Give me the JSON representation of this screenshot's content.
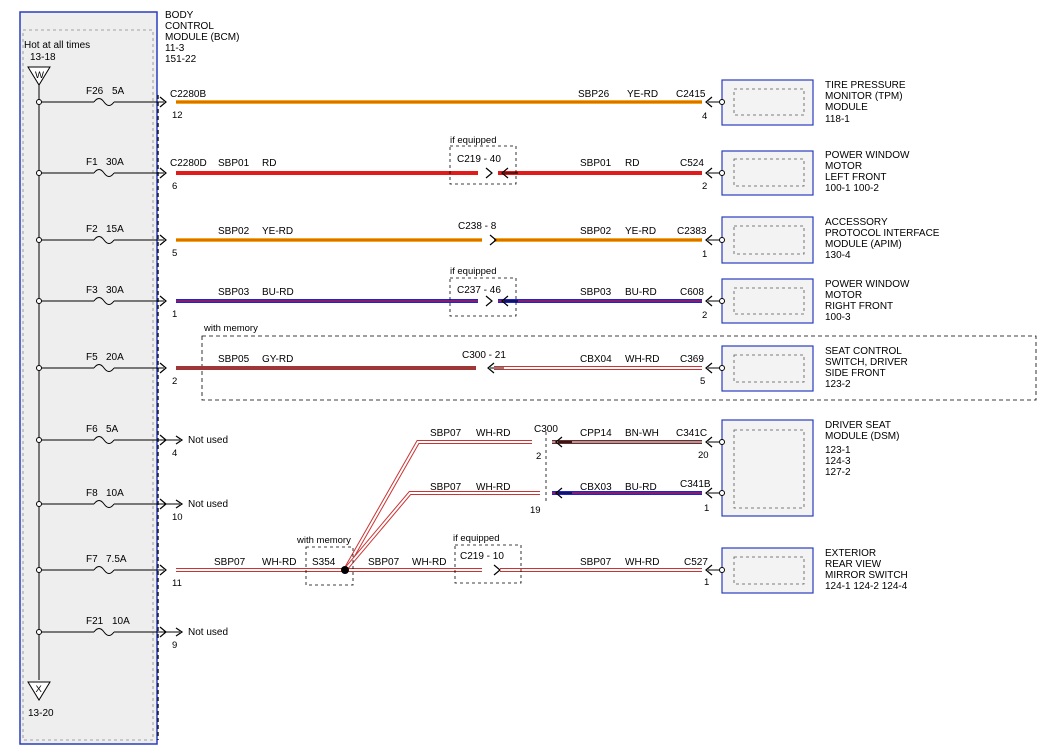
{
  "bcm": {
    "lines": [
      "BODY",
      "CONTROL",
      "MODULE (BCM)",
      "11-3",
      "151-22"
    ],
    "hot_label": "Hot at all times",
    "top_ref": "13-18",
    "top_terminal": "W",
    "bottom_terminal": "X",
    "bottom_ref": "13-20"
  },
  "colors": {
    "ye_rd": "#e8b400",
    "rd": "#e11a1a",
    "bu_rd": "#2323cc",
    "gy_rd": "#8a4040",
    "wh_rd": "#ffffff",
    "bn_wh": "#6b2d2d",
    "bu": "#2323cc",
    "stripe_rd": "#e11a1a",
    "stripe_dark": "#5a1a1a",
    "module_border": "#2a3cc0",
    "bcm_border": "#2a3cc0",
    "bcm_fill": "#eeeeee"
  },
  "fuses": [
    {
      "name": "F26",
      "rating": "5A"
    },
    {
      "name": "F1",
      "rating": "30A"
    },
    {
      "name": "F2",
      "rating": "15A"
    },
    {
      "name": "F3",
      "rating": "30A"
    },
    {
      "name": "F5",
      "rating": "20A"
    },
    {
      "name": "F6",
      "rating": "5A"
    },
    {
      "name": "F8",
      "rating": "10A"
    },
    {
      "name": "F7",
      "rating": "7.5A"
    },
    {
      "name": "F21",
      "rating": "10A"
    }
  ],
  "pins": [
    "12",
    "6",
    "5",
    "1",
    "2",
    "4",
    "10",
    "11",
    "9"
  ],
  "not_used": "Not used",
  "circuits": [
    {
      "left_conn": "C2280B",
      "right_circuit": "SBP26",
      "right_color": "YE-RD",
      "right_conn": "C2415",
      "right_pin": "4"
    },
    {
      "left_conn": "C2280D",
      "left_circuit": "SBP01",
      "left_color": "RD",
      "mid_conn": "C219 - 40",
      "mid_label": "if equipped",
      "right_circuit": "SBP01",
      "right_color": "RD",
      "right_conn": "C524",
      "right_pin": "2"
    },
    {
      "left_circuit": "SBP02",
      "left_color": "YE-RD",
      "mid_conn": "C238 - 8",
      "right_circuit": "SBP02",
      "right_color": "YE-RD",
      "right_conn": "C2383",
      "right_pin": "1"
    },
    {
      "left_circuit": "SBP03",
      "left_color": "BU-RD",
      "mid_conn": "C237 - 46",
      "mid_label": "if equipped",
      "right_circuit": "SBP03",
      "right_color": "BU-RD",
      "right_conn": "C608",
      "right_pin": "2"
    },
    {
      "group_label": "with memory",
      "left_circuit": "SBP05",
      "left_color": "GY-RD",
      "mid_conn": "C300 - 21",
      "right_circuit": "CBX04",
      "right_color": "WH-RD",
      "right_conn": "C369",
      "right_pin": "5"
    },
    {
      "upper_circuit": "SBP07",
      "upper_color": "WH-RD",
      "upper_conn": "C300",
      "upper_conn_pin": "2",
      "upper_right_circuit": "CPP14",
      "upper_right_color": "BN-WH",
      "upper_right_conn": "C341C",
      "upper_right_pin": "20",
      "lower_circuit": "SBP07",
      "lower_color": "WH-RD",
      "lower_conn_pin": "19",
      "lower_right_circuit": "CBX03",
      "lower_right_color": "BU-RD",
      "lower_right_conn": "C341B",
      "lower_right_pin": "1"
    },
    {
      "left_circuit": "SBP07",
      "left_color": "WH-RD",
      "splice_label": "with memory",
      "splice": "S354",
      "mid_circuit": "SBP07",
      "mid_color": "WH-RD",
      "mid_conn": "C219 - 10",
      "mid_label": "if equipped",
      "right_circuit": "SBP07",
      "right_color": "WH-RD",
      "right_conn": "C527",
      "right_pin": "1"
    }
  ],
  "modules": [
    {
      "lines": [
        "TIRE PRESSURE",
        "MONITOR (TPM)",
        "MODULE",
        "118-1"
      ]
    },
    {
      "lines": [
        "POWER WINDOW",
        "MOTOR",
        "LEFT FRONT",
        "100-1   100-2"
      ]
    },
    {
      "lines": [
        "ACCESSORY",
        "PROTOCOL INTERFACE",
        "MODULE (APIM)",
        "130-4"
      ]
    },
    {
      "lines": [
        "POWER WINDOW",
        "MOTOR",
        "RIGHT FRONT",
        "100-3"
      ]
    },
    {
      "lines": [
        "SEAT CONTROL",
        "SWITCH, DRIVER",
        "SIDE FRONT",
        "123-2"
      ]
    },
    {
      "lines": [
        "DRIVER SEAT",
        "MODULE (DSM)",
        "123-1",
        "124-3",
        "127-2"
      ]
    },
    {
      "lines": [
        "EXTERIOR",
        "REAR VIEW",
        "MIRROR SWITCH",
        "124-1   124-2   124-4"
      ]
    }
  ]
}
